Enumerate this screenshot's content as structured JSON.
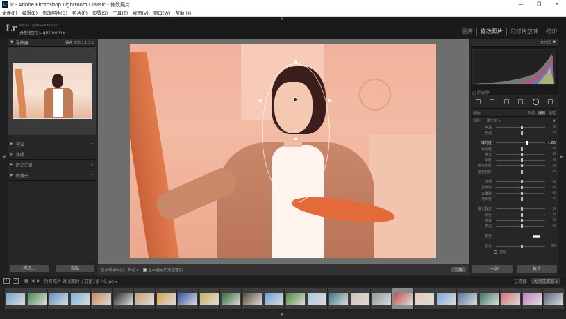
{
  "window": {
    "title": "lr - Adobe Photoshop Lightroom Classic - 修改照片",
    "controls": [
      "—",
      "❐",
      "✕"
    ]
  },
  "menu": [
    "文件(F)",
    "编辑(E)",
    "修改照片(D)",
    "照片(P)",
    "设置(S)",
    "工具(T)",
    "视图(V)",
    "窗口(W)",
    "帮助(H)"
  ],
  "identity": {
    "logo": "Lr",
    "line1": "Adobe Lightroom Classic",
    "line2": "开始使用 Lightroom ▸"
  },
  "modules": [
    "图库",
    "修改照片",
    "幻灯片放映",
    "打印"
  ],
  "active_module": "修改照片",
  "left": {
    "navigator": {
      "title": "导航器",
      "options": [
        "适合",
        "填满",
        "1:1",
        "3:1"
      ]
    },
    "sections": [
      "预设",
      "快照",
      "历史记录",
      "收藏夹"
    ],
    "buttons": {
      "copy": "拷贝...",
      "paste": "粘贴"
    }
  },
  "center": {
    "toolbar": {
      "label1": "显示编辑标记",
      "label1_value": "自动 ▸",
      "checkbox_label": "显示选定的蒙版叠加",
      "done": "完成"
    }
  },
  "right": {
    "histogram_label": "直方图",
    "original_label": "原始照片",
    "profile": {
      "left": "蒙版:",
      "tabs": [
        "新建",
        "编辑",
        "画笔"
      ]
    },
    "effect": {
      "label": "效果:",
      "value": "曝光度 ÷"
    },
    "sliders_a": [
      {
        "label": "色温",
        "value": "0"
      },
      {
        "label": "色调",
        "value": "0"
      }
    ],
    "exposure": {
      "label": "曝光度",
      "value": "1.06"
    },
    "sliders_b": [
      {
        "label": "对比度",
        "value": "0"
      },
      {
        "label": "高光",
        "value": "0"
      },
      {
        "label": "阴影",
        "value": "0"
      },
      {
        "label": "白色色阶",
        "value": "0"
      },
      {
        "label": "黑色色阶",
        "value": "0"
      }
    ],
    "sliders_c": [
      {
        "label": "纹理",
        "value": "0"
      },
      {
        "label": "清晰度",
        "value": "0"
      },
      {
        "label": "去朦胧",
        "value": "0"
      },
      {
        "label": "饱和度",
        "value": "0"
      }
    ],
    "sliders_d": [
      {
        "label": "锐化程度",
        "value": "0"
      },
      {
        "label": "杂色",
        "value": "0"
      },
      {
        "label": "波纹",
        "value": "0"
      },
      {
        "label": "去边",
        "value": "0"
      }
    ],
    "color": {
      "label": "颜色"
    },
    "feather": {
      "label": "羽化",
      "value": "50"
    },
    "flow_label": "自动",
    "buttons": {
      "prev": "上一张",
      "reset": "复位"
    }
  },
  "filmstrip": {
    "breadcrumb": "所有照片  28张照片 / 选定1张 / 6.jpg ▾",
    "filter_label": "过滤器:",
    "filter_value": "关闭过滤器 ▾",
    "thumbs": [
      "#7aa3c8",
      "#4c8a5a",
      "#5c93c7",
      "#7ab3d9",
      "#c98a5a",
      "#2b2b2b",
      "#c9a07a",
      "#d8a04a",
      "#3656a8",
      "#c9b060",
      "#2f6b3a",
      "#5a4a3a",
      "#6ea0d0",
      "#4e8a40",
      "#a8c8d8",
      "#3f7a8a",
      "#d0c0b0",
      "#8a9a9a",
      "#c05050",
      "#e8c8b8",
      "#7aa8d8",
      "#5a7aa0",
      "#3e7a60",
      "#d8707a",
      "#c080c0",
      "#5a6a7a"
    ],
    "selected_index": 18
  }
}
